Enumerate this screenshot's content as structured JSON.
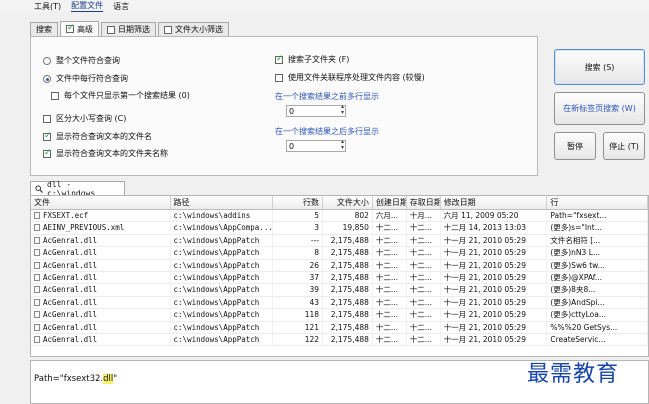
{
  "menu": {
    "items": [
      "工具(T)",
      "配置文件",
      "语言"
    ]
  },
  "tabs": [
    {
      "label": "搜索",
      "selected": false
    },
    {
      "label": "高级",
      "selected": true
    },
    {
      "label": "日期筛选",
      "selected": false
    },
    {
      "label": "文件大小筛选",
      "selected": false
    }
  ],
  "options": {
    "whole_file": "整个文件符合查询",
    "per_line": "文件中每行符合查询",
    "first_result_only": "每个文件只显示第一个搜索结果 (0)",
    "case_sensitive": "区分大小写查询 (C)",
    "show_file_name": "显示符合查询文本的文件名",
    "show_folder_name": "显示符合查询文本的文件夹名称",
    "search_subfolders": "搜索子文件夹 (F)",
    "use_associated": "使用文件关联程序处理文件内容 (较慢)",
    "lines_before_label": "在一个搜索结果之前多行显示",
    "lines_before_value": "0",
    "lines_after_label": "在一个搜索结果之后多行显示",
    "lines_after_value": "0"
  },
  "buttons": {
    "search": "搜索 (S)",
    "new_tab_search": "在新标签页搜索 (W)",
    "pause": "暂停",
    "stop": "停止 (T)"
  },
  "path_tab": {
    "label": "dll - c:\\windows"
  },
  "table": {
    "headers": [
      "文件",
      "路径",
      "行数",
      "文件大小",
      "创建日期",
      "存取日期",
      "修改日期",
      "行"
    ],
    "rows": [
      [
        "FXSEXT.ecf",
        "c:\\windows\\addins",
        "5",
        "802",
        "六月...",
        "十月...",
        "六月 11, 2009 05:20",
        "Path=\"fxsext..."
      ],
      [
        "AEINV_PREVIOUS.xml",
        "c:\\windows\\AppCompa...",
        "3",
        "19,850",
        "十二...",
        "十二...",
        "十二月 14, 2013 13:03",
        "(更多)s=\"Int..."
      ],
      [
        "AcGenral.dll",
        "c:\\windows\\AppPatch",
        "---",
        "2,175,488",
        "十二...",
        "十二...",
        "十一月 21, 2010 05:29",
        "文件名相符 [..."
      ],
      [
        "AcGenral.dll",
        "c:\\windows\\AppPatch",
        "8",
        "2,175,488",
        "十二...",
        "十二...",
        "十一月 21, 2010 05:29",
        "(更多)nN3 L..."
      ],
      [
        "AcGenral.dll",
        "c:\\windows\\AppPatch",
        "26",
        "2,175,488",
        "十二...",
        "十二...",
        "十一月 21, 2010 05:29",
        "(更多)Sw6 tw..."
      ],
      [
        "AcGenral.dll",
        "c:\\windows\\AppPatch",
        "37",
        "2,175,488",
        "十二...",
        "十二...",
        "十一月 21, 2010 05:29",
        "(更多)@XPAf..."
      ],
      [
        "AcGenral.dll",
        "c:\\windows\\AppPatch",
        "39",
        "2,175,488",
        "十二...",
        "十二...",
        "十一月 21, 2010 05:29",
        "(更多)8夹8..."
      ],
      [
        "AcGenral.dll",
        "c:\\windows\\AppPatch",
        "43",
        "2,175,488",
        "十二...",
        "十二...",
        "十一月 21, 2010 05:29",
        "(更多)AndSpi..."
      ],
      [
        "AcGenral.dll",
        "c:\\windows\\AppPatch",
        "118",
        "2,175,488",
        "十二...",
        "十二...",
        "十一月 21, 2010 05:29",
        "(更多)cttyLoa..."
      ],
      [
        "AcGenral.dll",
        "c:\\windows\\AppPatch",
        "121",
        "2,175,488",
        "十二...",
        "十二...",
        "十一月 21, 2010 05:29",
        "%%%20 GetSys..."
      ],
      [
        "AcGenral.dll",
        "c:\\windows\\AppPatch",
        "122",
        "2,175,488",
        "十二...",
        "十二...",
        "十一月 21, 2010 05:29",
        "CreateServic..."
      ]
    ]
  },
  "preview": {
    "prefix": "Path=\"fxsext32.",
    "highlight": "dll",
    "suffix": "\""
  },
  "watermark": "最需教育"
}
